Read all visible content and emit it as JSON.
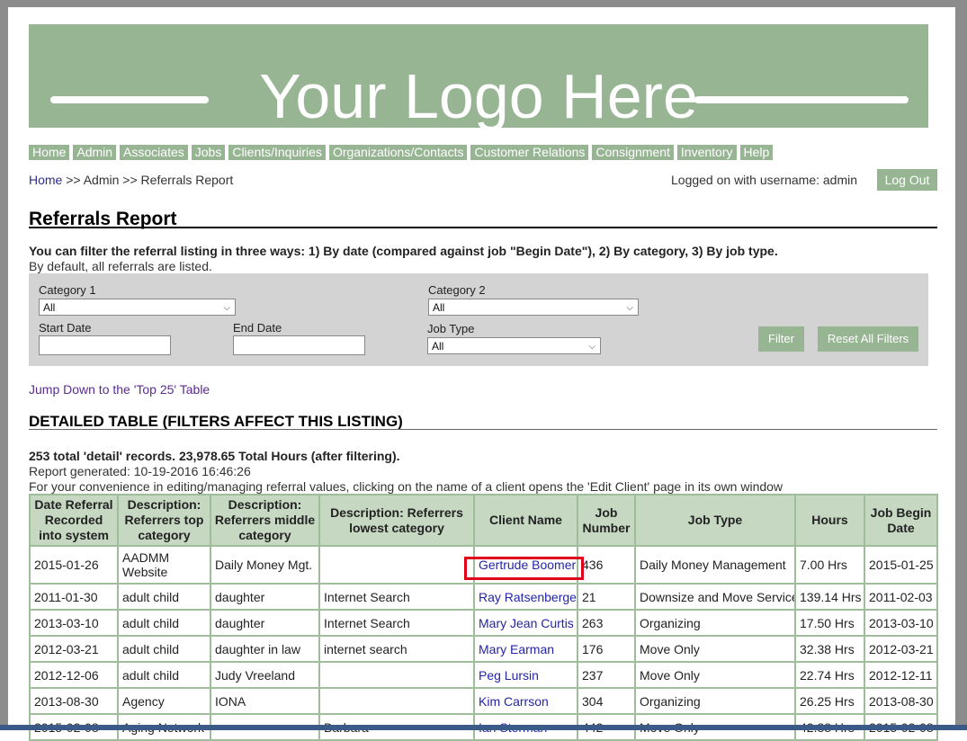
{
  "logo": {
    "text": "Your Logo Here"
  },
  "nav": [
    "Home",
    "Admin",
    "Associates",
    "Jobs",
    "Clients/Inquiries",
    "Organizations/Contacts",
    "Customer Relations",
    "Consignment",
    "Inventory",
    "Help"
  ],
  "breadcrumb": {
    "home": "Home",
    "sep1": " >> ",
    "admin": "Admin",
    "sep2": " >> ",
    "current": "Referrals Report"
  },
  "user": {
    "logged_text": "Logged on with username: admin",
    "logout_label": "Log Out"
  },
  "page_title": "Referrals Report",
  "filter_desc": "You can filter the referral listing in three ways: 1) By date (compared against job \"Begin Date\"), 2) By category, 3) By job type.",
  "filter_default": "By default, all referrals are listed.",
  "filters": {
    "category1_label": "Category 1",
    "category1_value": "All",
    "category2_label": "Category 2",
    "category2_value": "All",
    "start_date_label": "Start Date",
    "end_date_label": "End Date",
    "job_type_label": "Job Type",
    "job_type_value": "All",
    "filter_button": "Filter",
    "reset_button": "Reset All Filters"
  },
  "jump_link": "Jump Down to the 'Top 25' Table",
  "detail_heading": "DETAILED TABLE (FILTERS AFFECT THIS LISTING)",
  "summary": "253 total 'detail' records. 23,978.65 Total Hours (after filtering).",
  "generated": "Report generated: 10-19-2016 16:46:26",
  "convenience": "For your convenience in editing/managing referral values, clicking on the name of a client opens the 'Edit Client' page in its own window",
  "table": {
    "headers": [
      "Date Referral Recorded into system",
      "Description: Referrers top category",
      "Description: Referrers middle category",
      "Description: Referrers lowest category",
      "Client Name",
      "Job Number",
      "Job Type",
      "Hours",
      "Job Begin Date"
    ],
    "rows": [
      [
        "2015-01-26",
        "AADMM Website",
        "Daily Money Mgt.",
        "",
        "Gertrude Boomer",
        "436",
        "Daily Money Management",
        "7.00 Hrs",
        "2015-01-25"
      ],
      [
        "2011-01-30",
        "adult child",
        "daughter",
        "Internet Search",
        "Ray Ratsenberger",
        "21",
        "Downsize and Move Services",
        "139.14 Hrs",
        "2011-02-03"
      ],
      [
        "2013-03-10",
        "adult child",
        "daughter",
        "Internet Search",
        "Mary Jean Curtis",
        "263",
        "Organizing",
        "17.50 Hrs",
        "2013-03-10"
      ],
      [
        "2012-03-21",
        "adult child",
        "daughter in law",
        "internet search",
        "Mary Earman",
        "176",
        "Move Only",
        "32.38 Hrs",
        "2012-03-21"
      ],
      [
        "2012-12-06",
        "adult child",
        "Judy Vreeland",
        "",
        "Peg Lursin",
        "237",
        "Move Only",
        "22.74 Hrs",
        "2012-12-11"
      ],
      [
        "2013-08-30",
        "Agency",
        "IONA",
        "",
        "Kim Carrson",
        "304",
        "Organizing",
        "26.25 Hrs",
        "2013-08-30"
      ],
      [
        "2015-02-08",
        "Aging Network",
        "",
        "Barbara",
        "Ian Sterman",
        "442",
        "Move Only",
        "42.88 Hrs",
        "2015-02-08"
      ]
    ]
  }
}
